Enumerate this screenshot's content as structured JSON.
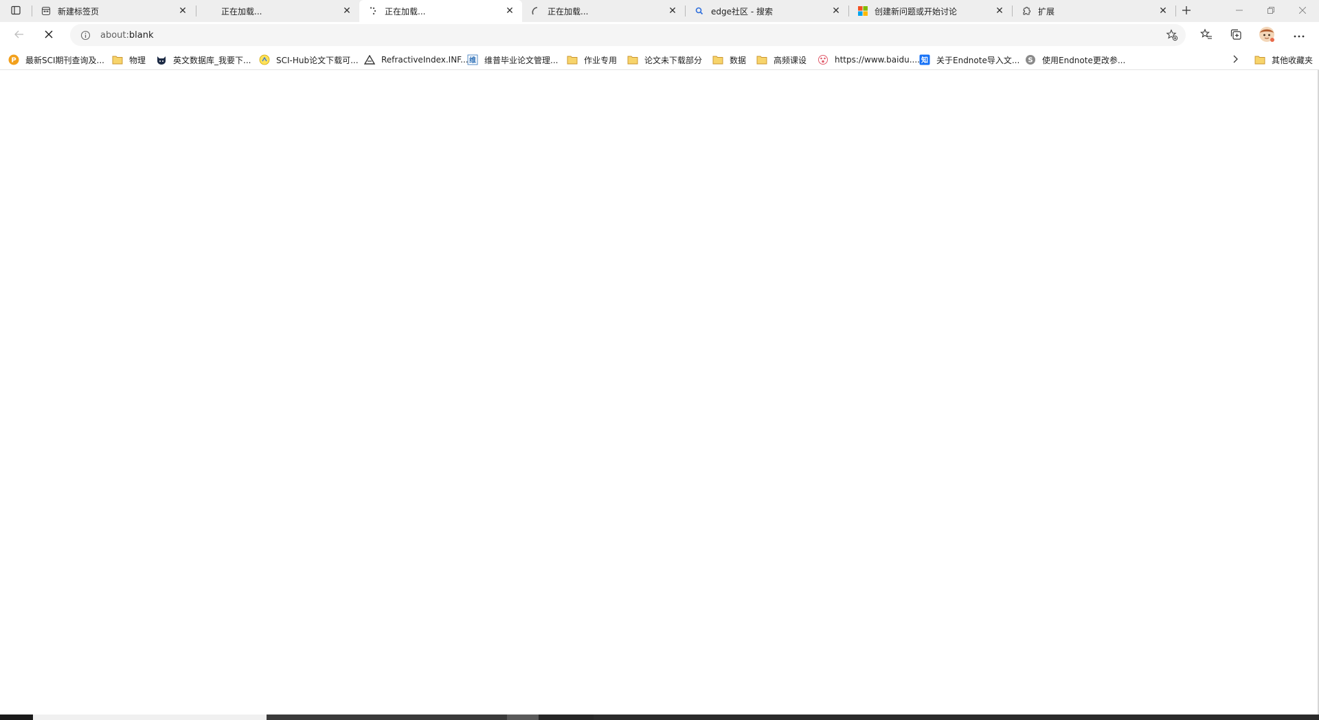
{
  "tabs": [
    {
      "title": "新建标签页",
      "favicon": "newtab-icon",
      "active": false
    },
    {
      "title": "正在加载...",
      "favicon": "",
      "active": false
    },
    {
      "title": "正在加载...",
      "favicon": "loading-spinner-icon",
      "active": true
    },
    {
      "title": "正在加载...",
      "favicon": "loading-arc-icon",
      "active": false
    },
    {
      "title": "edge社区 - 搜索",
      "favicon": "search-icon",
      "active": false
    },
    {
      "title": "创建新问题或开始讨论",
      "favicon": "microsoft-logo-icon",
      "active": false
    },
    {
      "title": "扩展",
      "favicon": "puzzle-icon",
      "active": false
    }
  ],
  "toolbar": {
    "url_prefix": "about:",
    "url_rest": "blank"
  },
  "bookmarks": [
    {
      "label": "最新SCI期刊查询及...",
      "icon": "sci-p-icon"
    },
    {
      "label": "物理",
      "icon": "folder-icon"
    },
    {
      "label": "英文数据库_我要下...",
      "icon": "cat-icon"
    },
    {
      "label": "SCI-Hub论文下载可...",
      "icon": "scihub-icon"
    },
    {
      "label": "RefractiveIndex.INF...",
      "icon": "triangle-logo-icon"
    },
    {
      "label": "维普毕业论文管理...",
      "icon": "weipu-icon"
    },
    {
      "label": "作业专用",
      "icon": "folder-icon"
    },
    {
      "label": "论文未下载部分",
      "icon": "folder-icon"
    },
    {
      "label": "数据",
      "icon": "folder-icon"
    },
    {
      "label": "高频课设",
      "icon": "folder-icon"
    },
    {
      "label": "https://www.baidu....",
      "icon": "baidu-icon"
    },
    {
      "label": "关于Endnote导入文...",
      "icon": "zhihu-icon"
    },
    {
      "label": "使用Endnote更改参...",
      "icon": "s-circle-icon"
    }
  ],
  "other_bookmarks": "其他收藏夹",
  "colors": {
    "tabstrip": "#eeeeee",
    "omnibox": "#f5f5f5",
    "folder": "#e8b948",
    "search_icon": "#2f6fdc"
  }
}
